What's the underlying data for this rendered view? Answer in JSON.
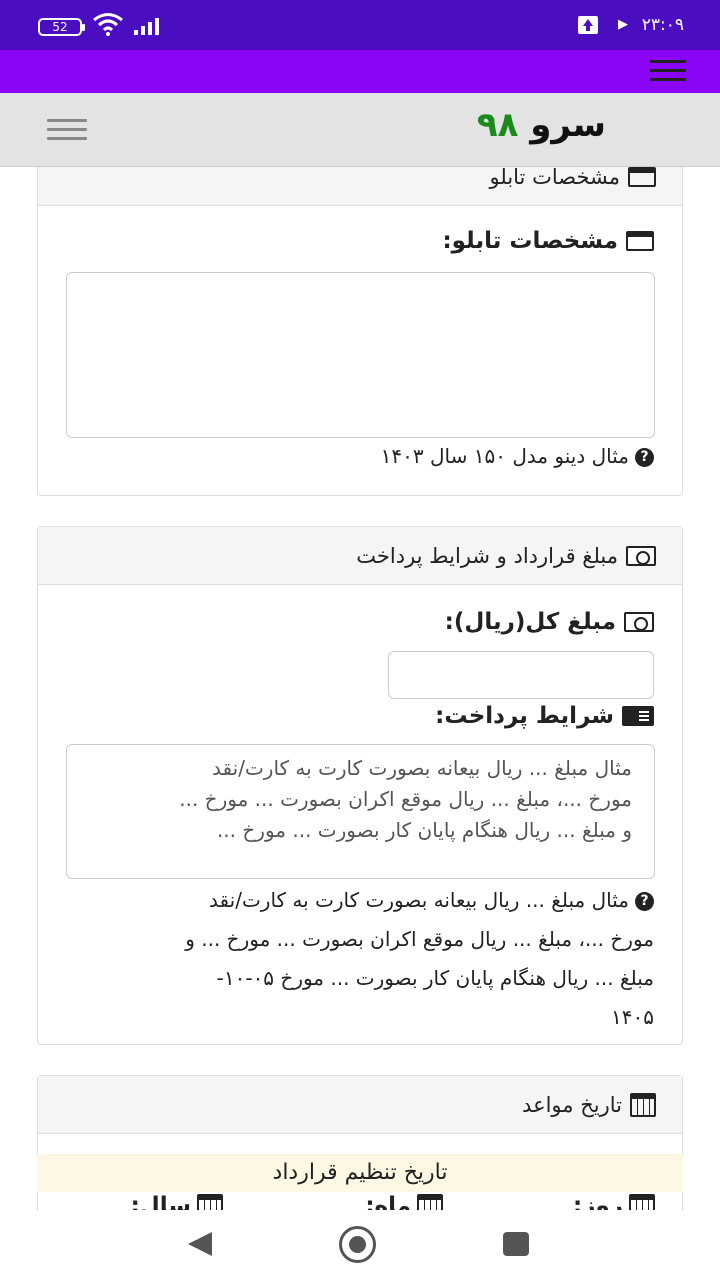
{
  "status_bar": {
    "battery": "52",
    "time": "۲۳:۰۹",
    "icons": [
      "battery-icon",
      "wifi-icon",
      "signal-icon",
      "upload-icon",
      "play-icon"
    ]
  },
  "header": {
    "brand_text": "سرو",
    "brand_number": "۹۸"
  },
  "panel_specs": {
    "heading": "مشخصات تابلو",
    "label": "مشخصات تابلو:",
    "textarea_value": "",
    "hint": "مثال دینو مدل ۱۵۰ سال ۱۴۰۳"
  },
  "panel_contract": {
    "heading": "مبلغ قرارداد و شرایط پرداخت",
    "amount_label": "مبلغ کل(ریال):",
    "amount_value": "",
    "terms_label": "شرایط پرداخت:",
    "terms_placeholder_lines": [
      "مثال مبلغ ... ریال بیعانه بصورت کارت به کارت/نقد",
      "مورخ ...، مبلغ ... ریال موقع اکران بصورت ... مورخ ...",
      "و مبلغ ... ریال هنگام پایان کار بصورت ... مورخ ..."
    ],
    "terms_hint_lines": [
      "مثال مبلغ ... ریال بیعانه بصورت کارت به کارت/نقد",
      "مورخ ...، مبلغ ... ریال موقع اکران بصورت ... مورخ ... و",
      "مبلغ ... ریال هنگام پایان کار بصورت ... مورخ ۰۵-۱۰-",
      "۱۴۰۵"
    ]
  },
  "panel_dates": {
    "heading": "تاریخ مواعد",
    "contract_date_label": "تاریخ تنظیم قرارداد",
    "columns": [
      "روز:",
      "ماه:",
      "سال:"
    ]
  },
  "colors": {
    "status_bar": "#4a0ec0",
    "purple_bar": "#8a05f4",
    "navbar": "#e3e3e3",
    "brand_number": "#1a8a1a",
    "date_highlight": "#fcf8e3"
  }
}
